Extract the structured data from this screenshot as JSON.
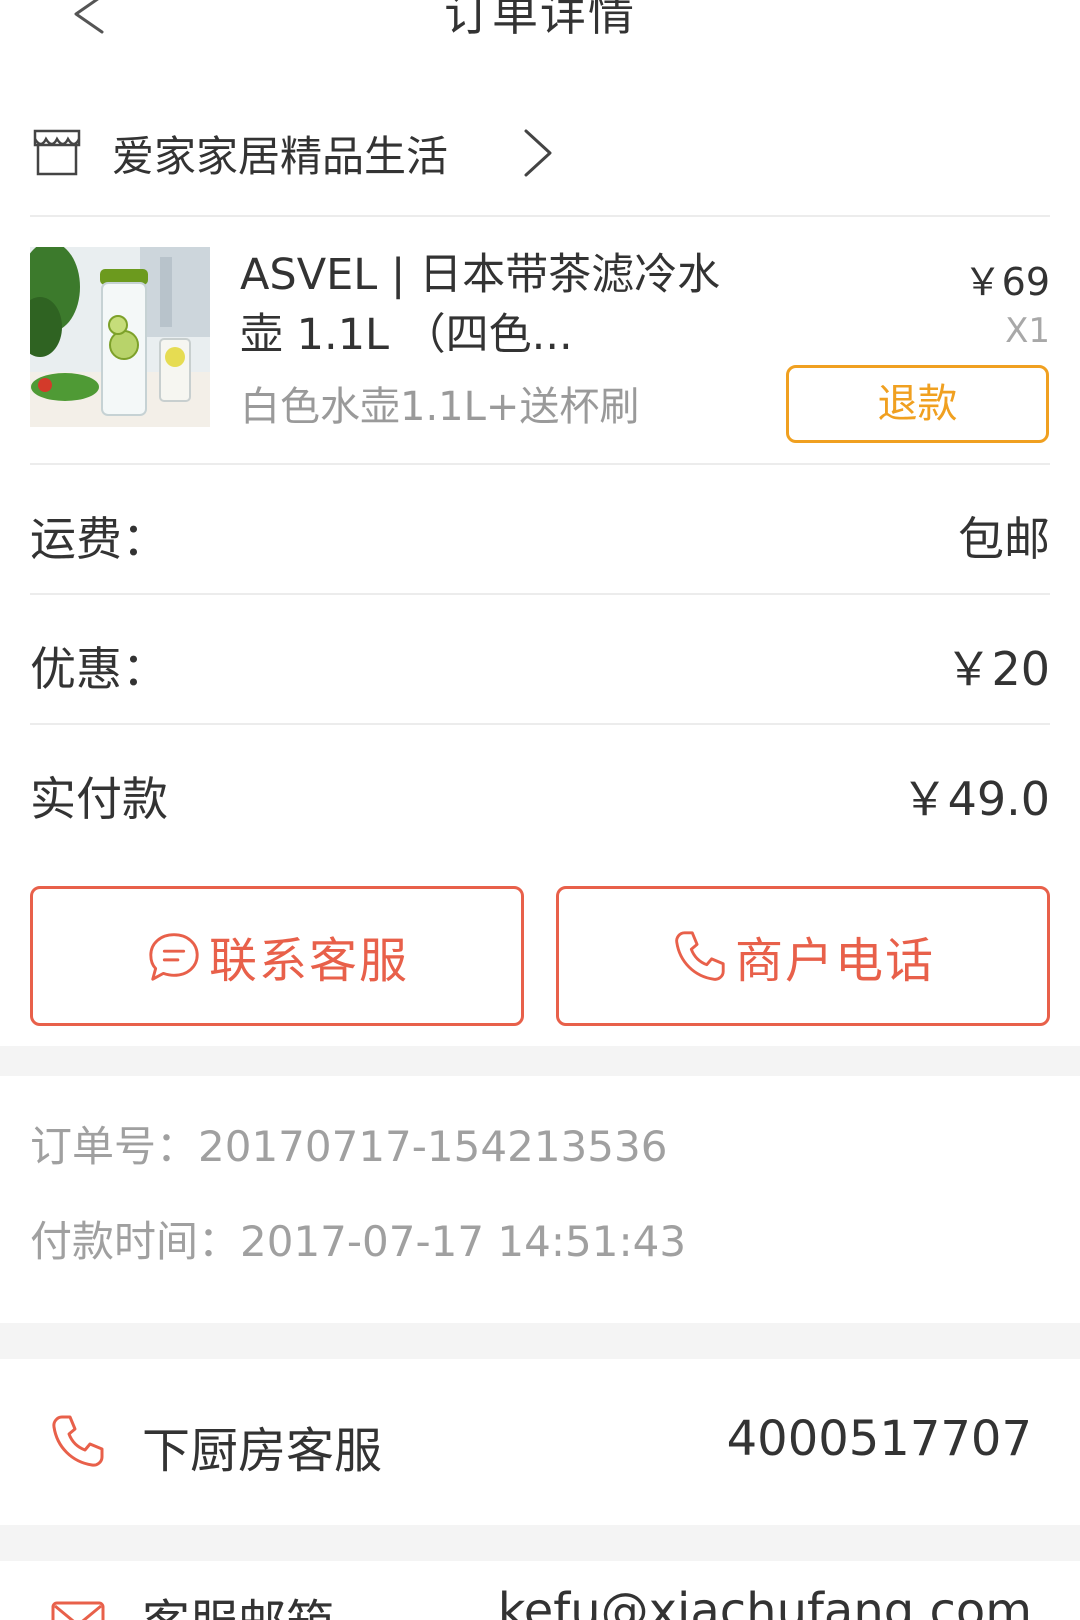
{
  "header": {
    "title": "订单详情"
  },
  "shop": {
    "name": "爱家家居精品生活"
  },
  "product": {
    "title": "ASVEL | 日本带茶滤冷水壶 1.1L （四色...",
    "spec": "白色水壶1.1L+送杯刷",
    "price": "￥69",
    "quantity": "X1",
    "refund_label": "退款"
  },
  "summary": {
    "shipping_label": "运费：",
    "shipping_value": "包邮",
    "discount_label": "优惠：",
    "discount_value": "￥20",
    "paid_label": "实付款",
    "paid_value": "￥49.0"
  },
  "actions": {
    "contact_service_label": "联系客服",
    "merchant_phone_label": "商户电话"
  },
  "order_info": {
    "order_no": "订单号：20170717-154213536",
    "pay_time": "付款时间：2017-07-17 14:51:43"
  },
  "support": {
    "phone_label": "下厨房客服",
    "phone_value": "4000517707",
    "email_label": "客服邮箱",
    "email_value": "kefu@xiachufang.com"
  },
  "colors": {
    "accent": "#e8604a",
    "refund": "#f0a020",
    "muted": "#a0a0a0",
    "band": "#f4f4f4"
  },
  "icons": [
    "back-icon",
    "store-icon",
    "chevron-right-icon",
    "chat-icon",
    "phone-icon",
    "mail-icon"
  ]
}
